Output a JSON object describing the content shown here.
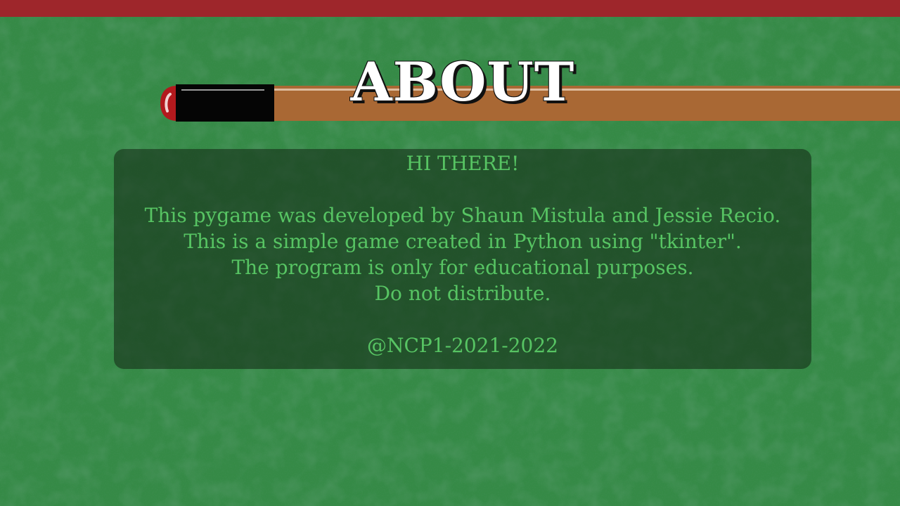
{
  "screen": {
    "title": "ABOUT"
  },
  "about": {
    "greeting": "HI THERE!",
    "lines": [
      "This pygame was developed by Shaun Mistula and Jessie Recio.",
      "This is a simple game created in Python using \"tkinter\".",
      "The program is only for educational purposes.",
      "Do not distribute."
    ],
    "credit": "@NCP1-2021-2022"
  },
  "colors": {
    "felt": "#358a46",
    "top_bar": "#9e262b",
    "cue_wood": "#a96834",
    "cue_butt": "#050505",
    "cue_tip": "#b3191d",
    "text": "#57c463",
    "panel": "#1f4424"
  },
  "icons": {
    "cue": "pool-cue-icon"
  }
}
